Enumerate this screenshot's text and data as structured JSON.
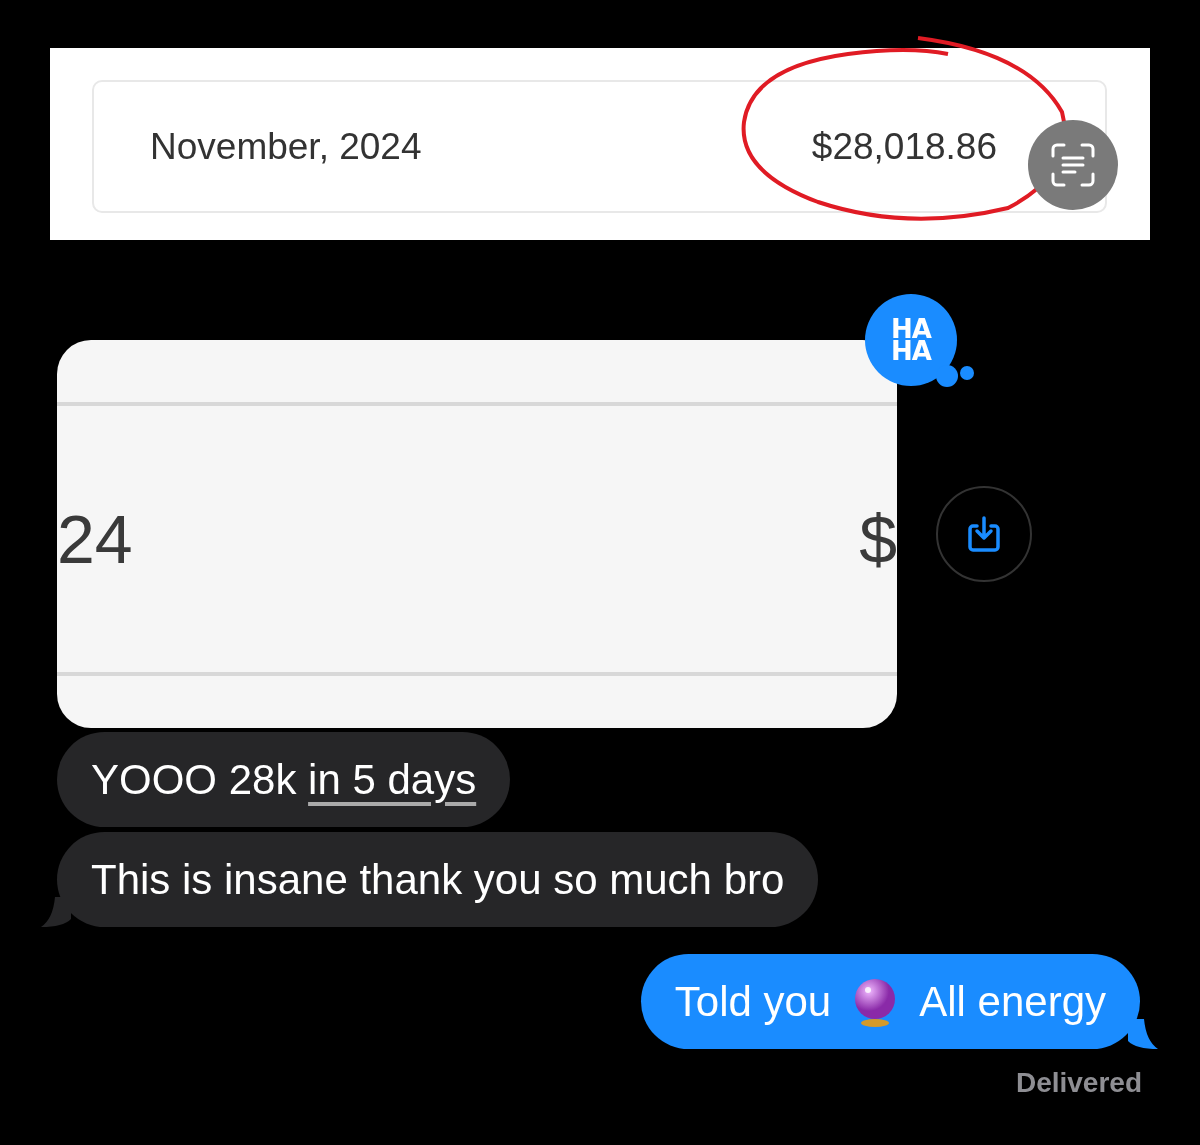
{
  "shared_screenshot": {
    "month": "November, 2024",
    "amount": "$28,018.86",
    "amount_circled": true
  },
  "image_message": {
    "left_text": "24",
    "right_text": "$",
    "reaction": {
      "line_1": "HA",
      "line_2": "HA"
    }
  },
  "messages": [
    {
      "outgoing": false,
      "tail": false,
      "parts": [
        {
          "kind": "plain",
          "text": "YOOO 28k "
        },
        {
          "kind": "link",
          "text": "in 5 days"
        }
      ]
    },
    {
      "outgoing": false,
      "tail": true,
      "parts": [
        {
          "kind": "plain",
          "text": "This is insane thank you so much bro"
        }
      ]
    },
    {
      "outgoing": true,
      "tail": true,
      "parts": [
        {
          "kind": "plain",
          "text": "Told you"
        },
        {
          "kind": "emoji"
        },
        {
          "kind": "plain",
          "text": "All energy"
        }
      ]
    }
  ],
  "status": "Delivered"
}
